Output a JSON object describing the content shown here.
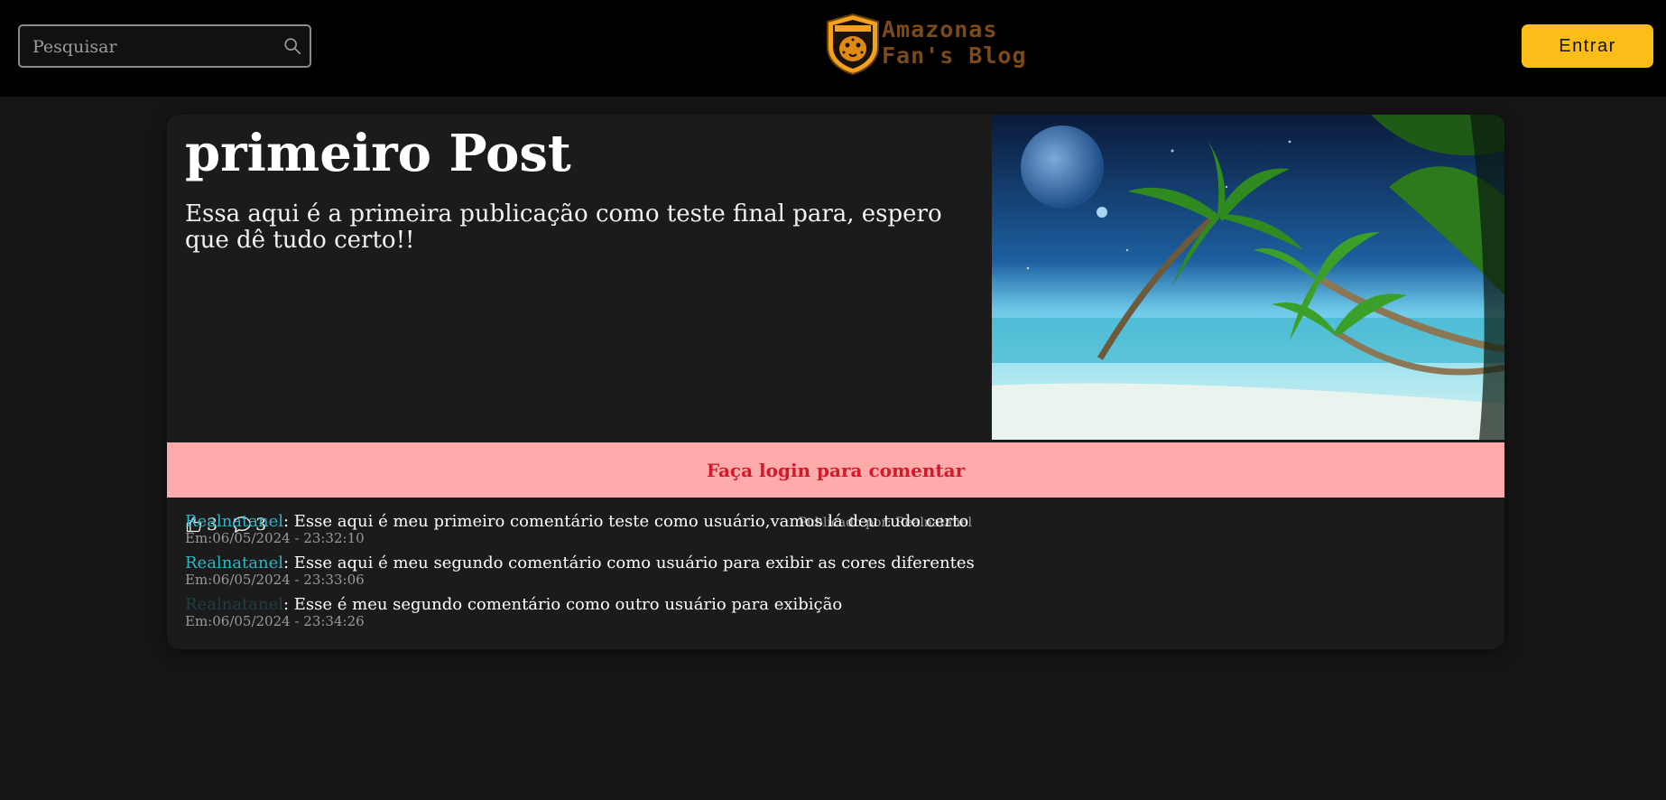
{
  "header": {
    "search": {
      "placeholder": "Pesquisar"
    },
    "logo": {
      "line1": "Amazonas",
      "line2": "Fan's Blog",
      "badge_text": "AMAZONAS F.C"
    },
    "login_label": "Entrar"
  },
  "post": {
    "title": "primeiro Post",
    "body": "Essa aqui é a primeira publicação como teste final para, espero que dê tudo certo!!",
    "likes": "3",
    "comments_count": "3",
    "author_line": "Publicado por: Realnatanel",
    "image_icon": "beach-palm-image"
  },
  "login_banner": "Faça login para comentar",
  "comments": [
    {
      "user": "Realnatanel",
      "text": ": Esse aqui é meu primeiro comentário teste como usuário,vamos lá deu tudo certo",
      "date": "Em:06/05/2024 - 23:32:10"
    },
    {
      "user": "Realnatanel",
      "text": ": Esse aqui é meu segundo comentário como usuário para exibir as cores diferentes",
      "date": "Em:06/05/2024 - 23:33:06"
    },
    {
      "user": "Realnatanel",
      "text": ": Esse é meu segundo comentário como outro usuário para exibição",
      "date": "Em:06/05/2024 - 23:34:26"
    }
  ],
  "colors": {
    "accent": "#fbbd18",
    "comment_user": "#2ab6c8",
    "banner_bg": "#ffabab",
    "banner_text": "#d4192b"
  }
}
